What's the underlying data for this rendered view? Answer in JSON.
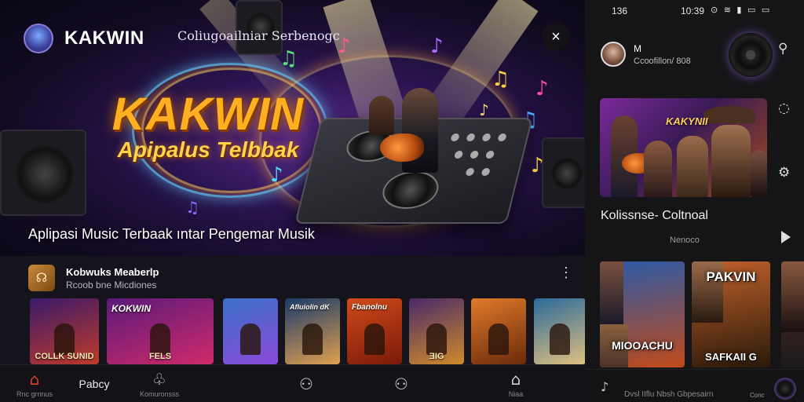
{
  "hero": {
    "brand_name": "KAKWIN",
    "subtitle": "Coliugoailniar Serbenogc",
    "logo_title": "KAKWIN",
    "logo_tagline": "Apipalus Telbbak",
    "caption": "Aplipasi Music Terbaak ıntar Pengemar Musik",
    "close_icon": "×"
  },
  "featured_row": {
    "title": "Kobwuks Meaberlp",
    "subtitle": "Rcoob bne Micdiones",
    "more_icon": "⋮",
    "cards": [
      {
        "top_label": "",
        "bottom_label": "COLLK SUNID",
        "color_a": "#3a1a6a",
        "color_b": "#c03a2a"
      },
      {
        "top_label": "KOKWIN",
        "bottom_label": "FELS",
        "color_a": "#5a1a7a",
        "color_b": "#d02a6a"
      },
      {
        "top_label": "",
        "bottom_label": "",
        "color_a": "#3a70c8",
        "color_b": "#8a4ad8"
      },
      {
        "top_label": "Afluiolin dK",
        "bottom_label": "",
        "color_a": "#1a3a6a",
        "color_b": "#e0a050"
      },
      {
        "top_label": "Fbanolnu",
        "bottom_label": "",
        "color_a": "#d04a1a",
        "color_b": "#7a1a0a"
      },
      {
        "top_label": "",
        "bottom_label": "ƎIG",
        "color_a": "#4a2a6a",
        "color_b": "#d08a2a"
      },
      {
        "top_label": "",
        "bottom_label": "",
        "color_a": "#e07a2a",
        "color_b": "#6a2a0a"
      },
      {
        "top_label": "",
        "bottom_label": "",
        "color_a": "#2a6a9a",
        "color_b": "#e0c080"
      }
    ]
  },
  "bottom_nav": {
    "items": [
      {
        "icon": "⌂",
        "label": "Rnc grnnus"
      },
      {
        "icon": "",
        "label": "Pabcy"
      },
      {
        "icon": "♧",
        "label": "Komuronsss"
      },
      {
        "icon": "⚇",
        "label": ""
      },
      {
        "icon": "⚇",
        "label": ""
      },
      {
        "icon": "⌂",
        "label": "Niaa"
      }
    ]
  },
  "right_panel": {
    "status": {
      "left_time": "136",
      "right_time": "10:39",
      "icons": "⊙ ≋ ▮ ▭ ▭"
    },
    "profile": {
      "name": "M",
      "subtitle": "Ccoofillon/ 808"
    },
    "feature_title": "KAKYNII",
    "collection_title": "Kolissnse- Coltnoal",
    "collection_sub": "Nenoco",
    "side_icons": {
      "search": "⚲",
      "like": "◌",
      "settings": "⚙"
    },
    "cards": [
      {
        "label": "MIOOACHU",
        "color_a": "#2a5aa8",
        "color_b": "#c04a1a"
      },
      {
        "label": "PAKVIN",
        "label2": "SAFKAII G",
        "color_a": "#c0602a",
        "color_b": "#2a1a0a"
      },
      {
        "label": "",
        "color_a": "#5a2a2a",
        "color_b": "#1a1a1a"
      }
    ],
    "nav": {
      "text": "Dvsl IIflu Nbsh Gbpesairn",
      "label": "Conc",
      "left_icon": "♪"
    }
  }
}
